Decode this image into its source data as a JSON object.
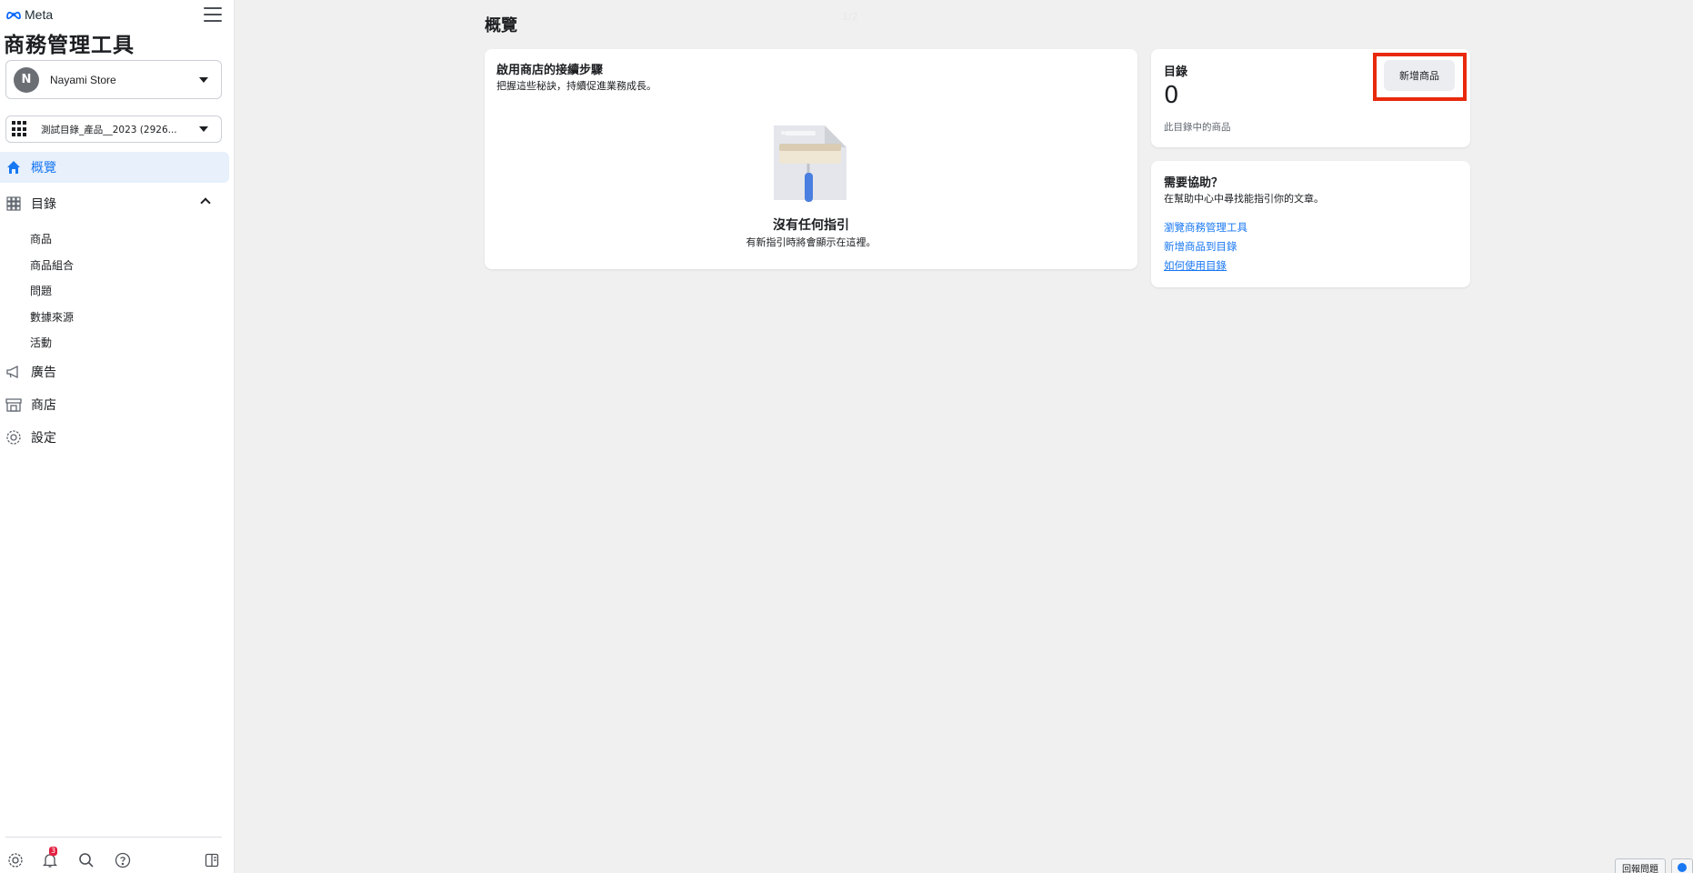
{
  "brand": {
    "meta_text": "Meta",
    "app_title": "商務管理工具"
  },
  "account": {
    "avatar_letter": "N",
    "name": "Nayami Store"
  },
  "catalog_selector": {
    "name": "測試目錄_產品__2023 (2926..."
  },
  "nav": {
    "overview": "概覽",
    "catalog": "目錄",
    "catalog_sub": [
      "商品",
      "商品組合",
      "問題",
      "數據來源",
      "活動"
    ],
    "ads": "廣告",
    "shop": "商店",
    "settings": "設定"
  },
  "bottom_bar": {
    "notification_count": "3"
  },
  "main": {
    "page_title": "概覽",
    "page_indicator": "1/2"
  },
  "setup_card": {
    "title": "啟用商店的接續步驟",
    "subtitle": "把握這些秘訣，持續促進業務成長。",
    "empty_title": "沒有任何指引",
    "empty_desc": "有新指引時將會顯示在這裡。"
  },
  "catalog_card": {
    "title": "目錄",
    "count": "0",
    "caption": "此目錄中的商品",
    "add_button": "新增商品"
  },
  "help_card": {
    "title": "需要協助？",
    "subtitle": "在幫助中心中尋找能指引你的文章。",
    "links": [
      "瀏覽商務管理工具",
      "新增商品到目錄",
      "如何使用目錄"
    ]
  },
  "footer": {
    "report_button": "回報問題"
  },
  "colors": {
    "accent": "#1877f2",
    "highlight_frame": "#e8290b",
    "background": "#f0f0f0"
  }
}
